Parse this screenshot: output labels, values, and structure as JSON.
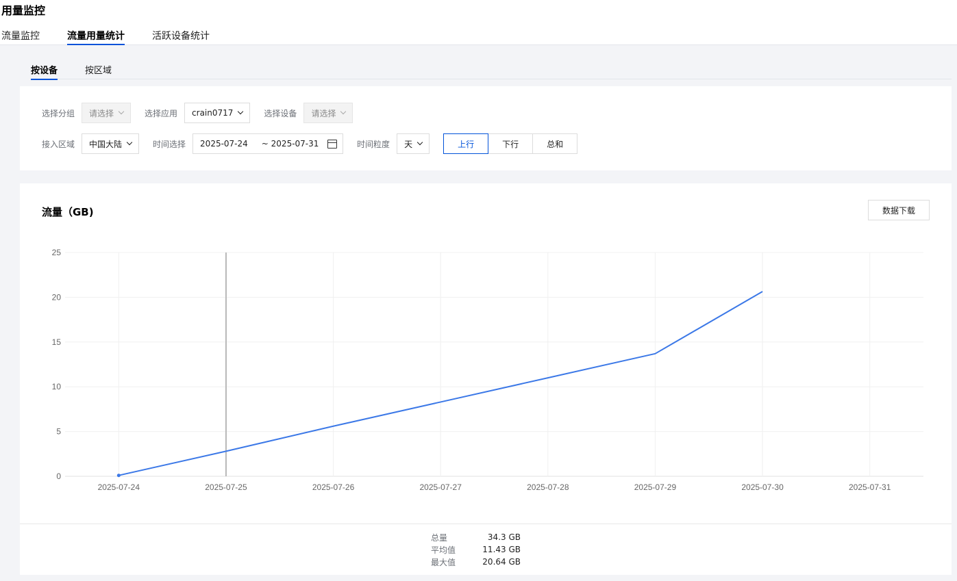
{
  "page_title": "用量监控",
  "main_tabs": [
    {
      "label": "流量监控",
      "active": false
    },
    {
      "label": "流量用量统计",
      "active": true
    },
    {
      "label": "活跃设备统计",
      "active": false
    }
  ],
  "sub_tabs": [
    {
      "label": "按设备",
      "active": true
    },
    {
      "label": "按区域",
      "active": false
    }
  ],
  "filters": {
    "group_label": "选择分组",
    "group_value": "请选择",
    "app_label": "选择应用",
    "app_value": "crain0717",
    "device_label": "选择设备",
    "device_value": "请选择",
    "region_label": "接入区域",
    "region_value": "中国大陆",
    "time_label": "时间选择",
    "date_start": "2025-07-24",
    "date_end": "~ 2025-07-31",
    "granularity_label": "时间粒度",
    "granularity_value": "天",
    "direction_options": [
      "上行",
      "下行",
      "总和"
    ],
    "direction_selected": "上行"
  },
  "chart_card": {
    "title": "流量（GB)",
    "download_label": "数据下载"
  },
  "chart_data": {
    "type": "line",
    "categories": [
      "2025-07-24",
      "2025-07-25",
      "2025-07-26",
      "2025-07-27",
      "2025-07-28",
      "2025-07-29",
      "2025-07-30",
      "2025-07-31"
    ],
    "series": [
      {
        "values": [
          0.1,
          2.8,
          5.6,
          8.3,
          11.0,
          13.7,
          20.64,
          null
        ]
      }
    ],
    "yticks": [
      "0",
      "5",
      "10",
      "15",
      "20",
      "25"
    ],
    "ylim": [
      0,
      25
    ],
    "hover_category": "2025-07-25",
    "grid": true,
    "line_color": "#3b78e7"
  },
  "summary": [
    {
      "label": "总量",
      "value": "34.3 GB"
    },
    {
      "label": "平均值",
      "value": "11.43 GB"
    },
    {
      "label": "最大值",
      "value": "20.64 GB"
    }
  ]
}
